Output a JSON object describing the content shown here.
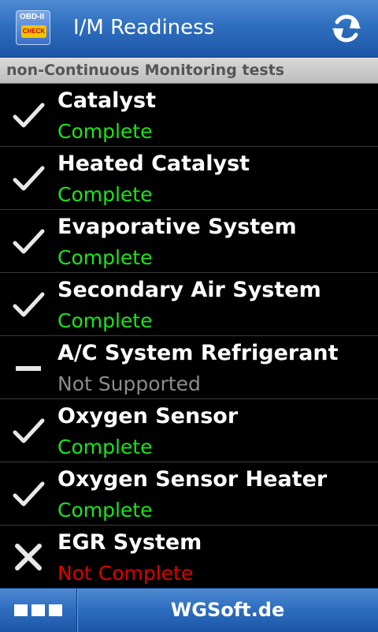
{
  "header": {
    "title": "I/M Readiness",
    "icon_top_text": "OBD-II",
    "icon_badge_text": "CHECK"
  },
  "section": {
    "title": "non-Continuous Monitoring tests"
  },
  "colors": {
    "complete": "#19e619",
    "not_supported": "#8c8c8c",
    "not_complete": "#e00000"
  },
  "tests": [
    {
      "name": "Catalyst",
      "status": "Complete",
      "state": "complete",
      "icon": "check-icon"
    },
    {
      "name": "Heated Catalyst",
      "status": "Complete",
      "state": "complete",
      "icon": "check-icon"
    },
    {
      "name": "Evaporative System",
      "status": "Complete",
      "state": "complete",
      "icon": "check-icon"
    },
    {
      "name": "Secondary Air System",
      "status": "Complete",
      "state": "complete",
      "icon": "check-icon"
    },
    {
      "name": "A/C System Refrigerant",
      "status": "Not Supported",
      "state": "not_supported",
      "icon": "dash-icon"
    },
    {
      "name": "Oxygen Sensor",
      "status": "Complete",
      "state": "complete",
      "icon": "check-icon"
    },
    {
      "name": "Oxygen Sensor Heater",
      "status": "Complete",
      "state": "complete",
      "icon": "check-icon"
    },
    {
      "name": "EGR System",
      "status": "Not Complete",
      "state": "not_complete",
      "icon": "cross-icon"
    }
  ],
  "footer": {
    "brand": "WGSoft.de",
    "menu_icon": "menu-icon"
  }
}
